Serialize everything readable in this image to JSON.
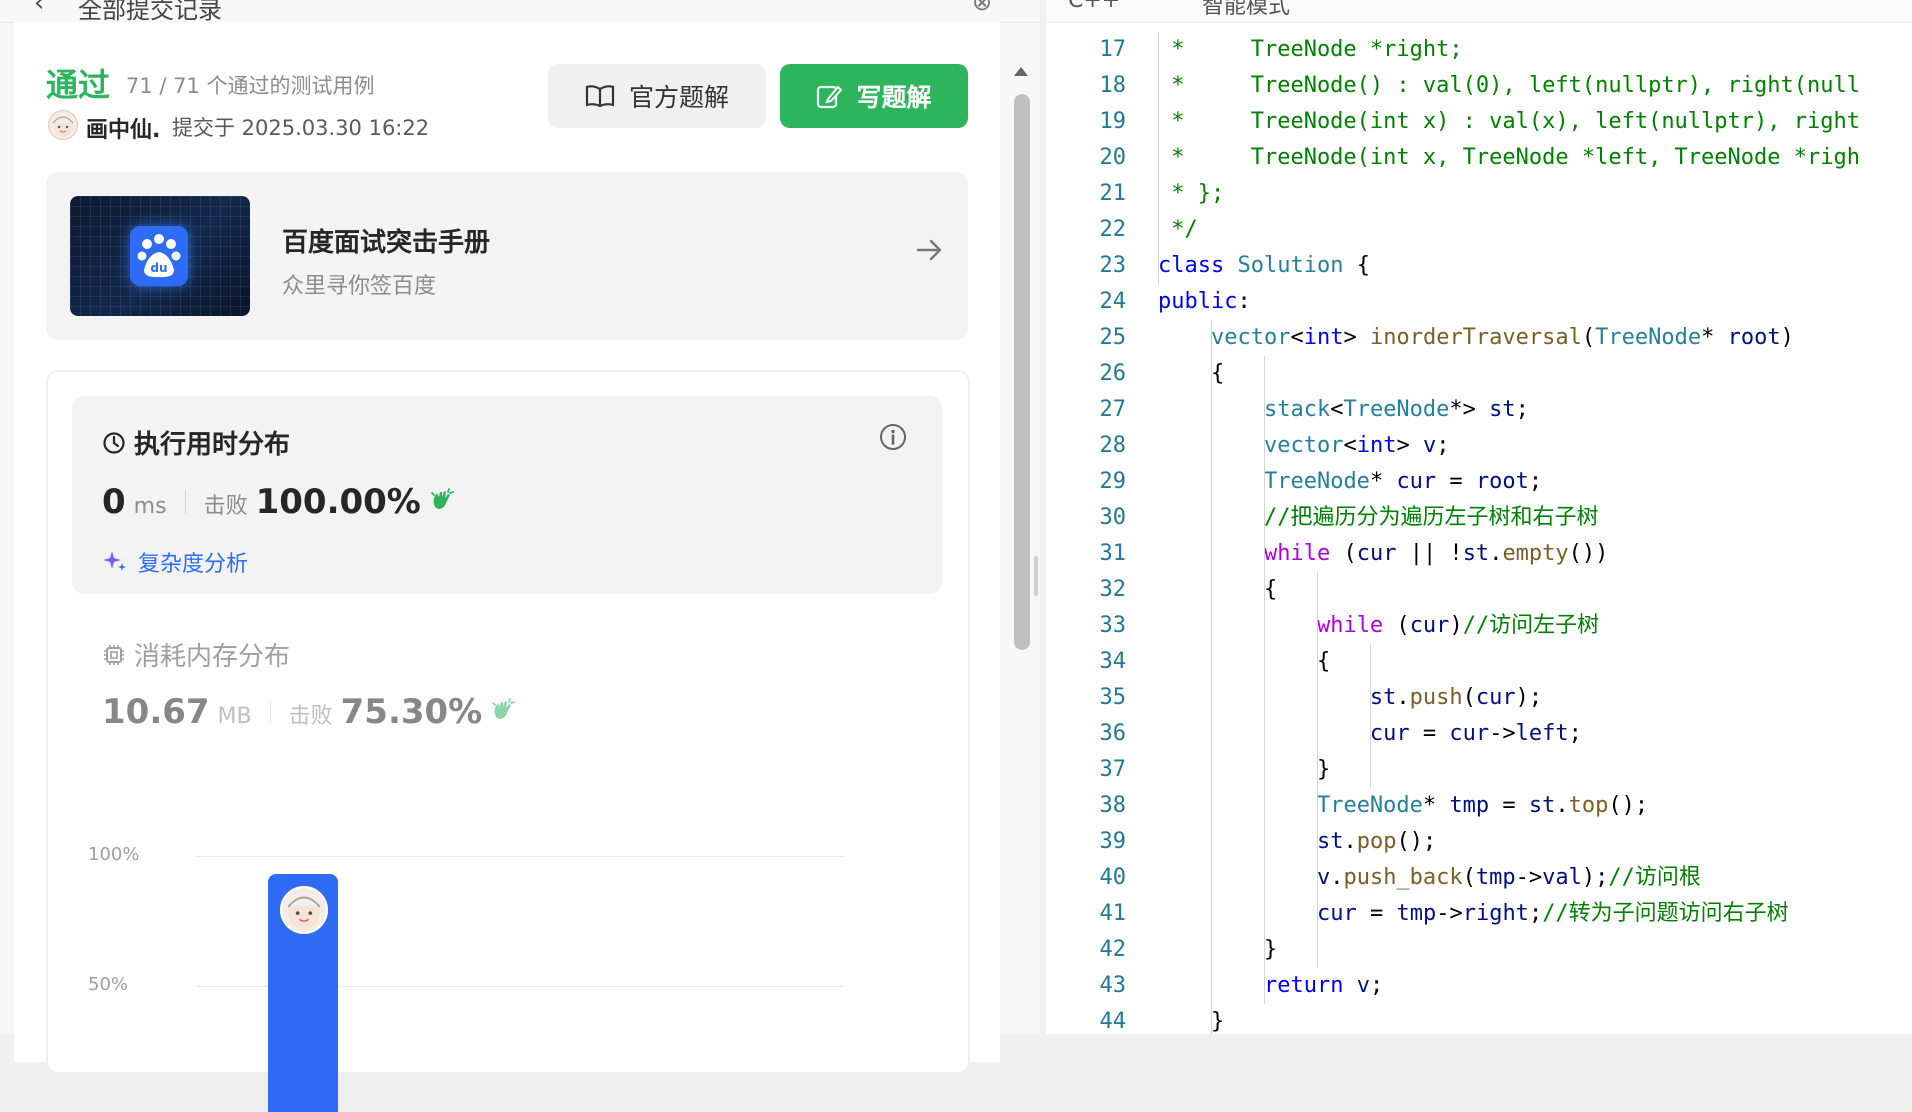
{
  "left_top": {
    "back_icon": "chevron-left-icon",
    "breadcrumb": "全部提交记录",
    "link_icon": "link-icon"
  },
  "submission": {
    "status": "通过",
    "cases": "71 / 71 个通过的测试用例",
    "user": "画中仙.",
    "submitted": "提交于 2025.03.30 16:22",
    "official_solution_label": "官方题解",
    "write_solution_label": "写题解"
  },
  "ad": {
    "title": "百度面试突击手册",
    "subtitle": "众里寻你签百度",
    "logo_text": "du"
  },
  "runtime": {
    "title": "执行用时分布",
    "value": "0",
    "unit": "ms",
    "beat_label": "击败",
    "beat_value": "100.00%",
    "complexity_label": "复杂度分析"
  },
  "memory": {
    "title": "消耗内存分布",
    "value": "10.67",
    "unit": "MB",
    "beat_label": "击败",
    "beat_value": "75.30%"
  },
  "chart": {
    "ytick_top": "100%",
    "ytick_mid": "50%",
    "bar_value": 1.0
  },
  "editor": {
    "lang": "C++",
    "mode": "智能模式",
    "lines": [
      {
        "n": "17",
        "code": " *     TreeNode *right;"
      },
      {
        "n": "18",
        "code": " *     TreeNode() : val(0), left(nullptr), right(null"
      },
      {
        "n": "19",
        "code": " *     TreeNode(int x) : val(x), left(nullptr), right"
      },
      {
        "n": "20",
        "code": " *     TreeNode(int x, TreeNode *left, TreeNode *righ"
      },
      {
        "n": "21",
        "code": " * };"
      },
      {
        "n": "22",
        "code": " */"
      },
      {
        "n": "23",
        "code": "class Solution {"
      },
      {
        "n": "24",
        "code": "public:"
      },
      {
        "n": "25",
        "code": "    vector<int> inorderTraversal(TreeNode* root)"
      },
      {
        "n": "26",
        "code": "    {"
      },
      {
        "n": "27",
        "code": "        stack<TreeNode*> st;"
      },
      {
        "n": "28",
        "code": "        vector<int> v;"
      },
      {
        "n": "29",
        "code": "        TreeNode* cur = root;"
      },
      {
        "n": "30",
        "code": "        //把遍历分为遍历左子树和右子树"
      },
      {
        "n": "31",
        "code": "        while (cur || !st.empty())"
      },
      {
        "n": "32",
        "code": "        {"
      },
      {
        "n": "33",
        "code": "            while (cur)//访问左子树"
      },
      {
        "n": "34",
        "code": "            {"
      },
      {
        "n": "35",
        "code": "                st.push(cur);"
      },
      {
        "n": "36",
        "code": "                cur = cur->left;"
      },
      {
        "n": "37",
        "code": "            }"
      },
      {
        "n": "38",
        "code": "            TreeNode* tmp = st.top();"
      },
      {
        "n": "39",
        "code": "            st.pop();"
      },
      {
        "n": "40",
        "code": "            v.push_back(tmp->val);//访问根"
      },
      {
        "n": "41",
        "code": "            cur = tmp->right;//转为子问题访问右子树"
      },
      {
        "n": "42",
        "code": "        }"
      },
      {
        "n": "43",
        "code": "        return v;"
      },
      {
        "n": "44",
        "code": "    }"
      }
    ]
  }
}
